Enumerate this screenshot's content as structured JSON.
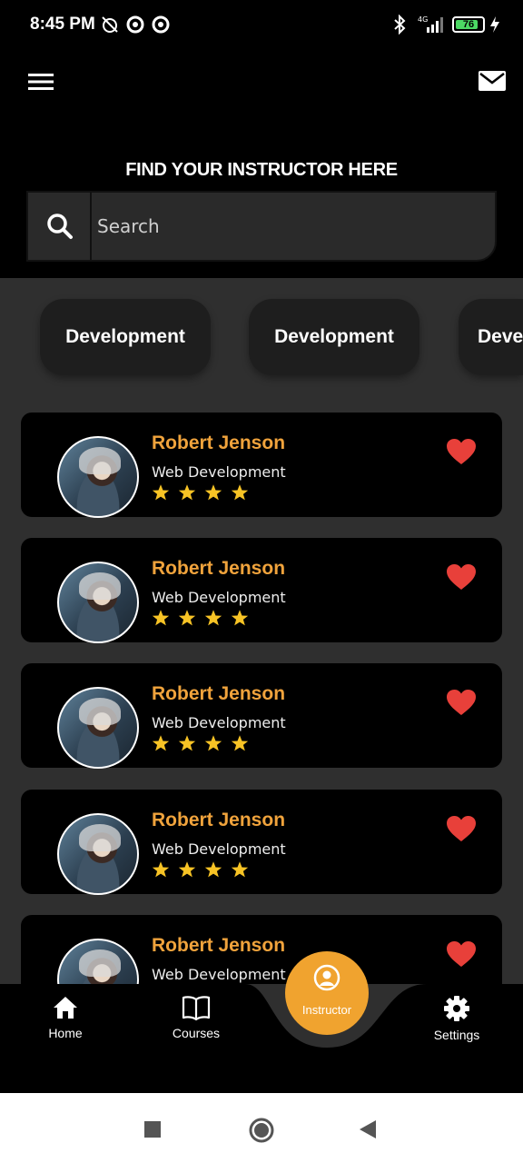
{
  "status_bar": {
    "time": "8:45 PM",
    "network": "4G",
    "battery": "76"
  },
  "header": {
    "title": "FIND YOUR INSTRUCTOR HERE",
    "menu_icon": "hamburger-menu-icon",
    "mail_icon": "mail-icon"
  },
  "search": {
    "placeholder": "Search",
    "value": ""
  },
  "categories": [
    {
      "label": "Development"
    },
    {
      "label": "Development"
    },
    {
      "label": "Deve"
    }
  ],
  "instructors": [
    {
      "name": "Robert Jenson",
      "role": "Web Development",
      "rating": 4
    },
    {
      "name": "Robert Jenson",
      "role": "Web Development",
      "rating": 4
    },
    {
      "name": "Robert Jenson",
      "role": "Web Development",
      "rating": 4
    },
    {
      "name": "Robert Jenson",
      "role": "Web Development",
      "rating": 4
    },
    {
      "name": "Robert Jenson",
      "role": "Web Development",
      "rating": 4
    }
  ],
  "nav": {
    "items": [
      {
        "label": "Home",
        "icon": "home-icon"
      },
      {
        "label": "Courses",
        "icon": "book-icon"
      },
      {
        "label": "Instructor",
        "icon": "user-icon"
      },
      {
        "label": "Settings",
        "icon": "gear-icon"
      }
    ]
  },
  "colors": {
    "accent": "#f0a33c",
    "heart": "#e8403a",
    "star": "#f7c325",
    "card_bg": "#000000",
    "main_bg": "#2f2f2f"
  }
}
